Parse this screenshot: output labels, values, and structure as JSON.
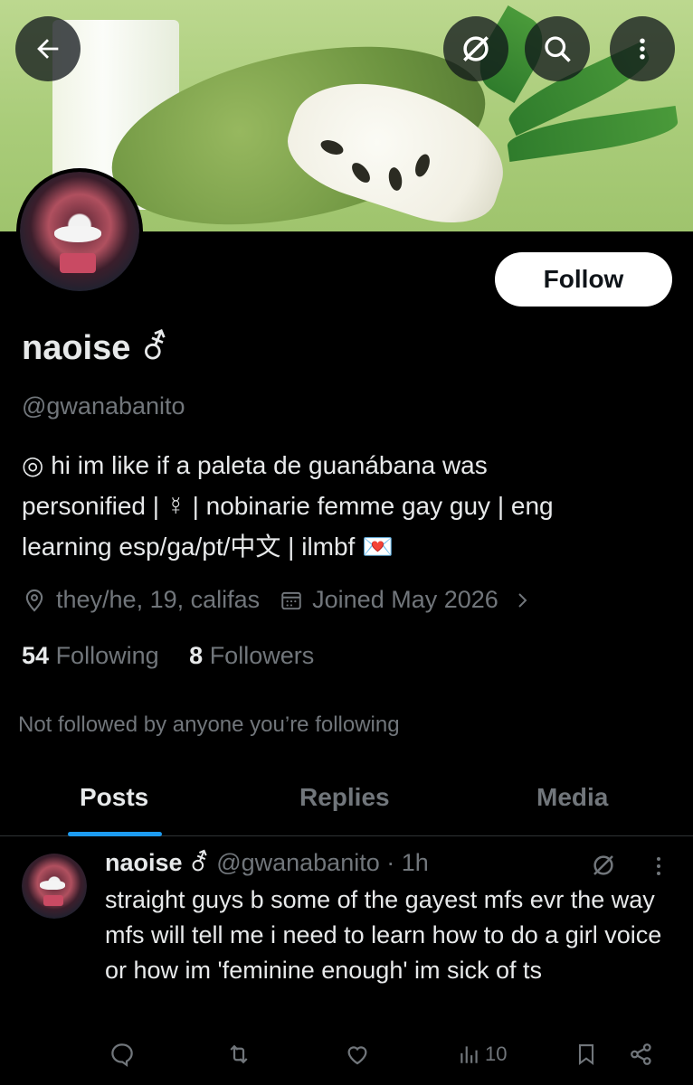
{
  "header": {
    "back_icon": "arrow-left-icon",
    "grok_icon": "grok-icon",
    "search_icon": "search-icon",
    "more_icon": "more-vertical-icon"
  },
  "profile": {
    "follow_label": "Follow",
    "display_name": "naoise ⚦",
    "handle": "@gwanabanito",
    "bio_line1": "◎ hi  im like if a  paleta de guanábana was",
    "bio_line2": "personified | ☿ | nobinarie femme gay guy | eng",
    "bio_line3": "learning esp/ga/pt/中文 | ilmbf 💌",
    "location": "they/he, 19, califas",
    "joined": "Joined May 2026",
    "following_count": "54",
    "following_label": "Following",
    "followers_count": "8",
    "followers_label": "Followers",
    "not_followed": "Not followed by anyone you’re following"
  },
  "tabs": [
    {
      "label": "Posts",
      "active": true
    },
    {
      "label": "Replies",
      "active": false
    },
    {
      "label": "Media",
      "active": false
    }
  ],
  "post": {
    "name": "naoise ⚦",
    "handle": "@gwanabanito",
    "time": "· 1h",
    "text": "straight guys b some of the gayest mfs evr the way mfs will tell me i need to learn how to do a girl voice or how im 'feminine enough' im sick of ts",
    "views": "10"
  },
  "colors": {
    "accent": "#1d9bf0",
    "background": "#000000",
    "secondary_text": "#71767b",
    "primary_text": "#e7e9ea"
  }
}
